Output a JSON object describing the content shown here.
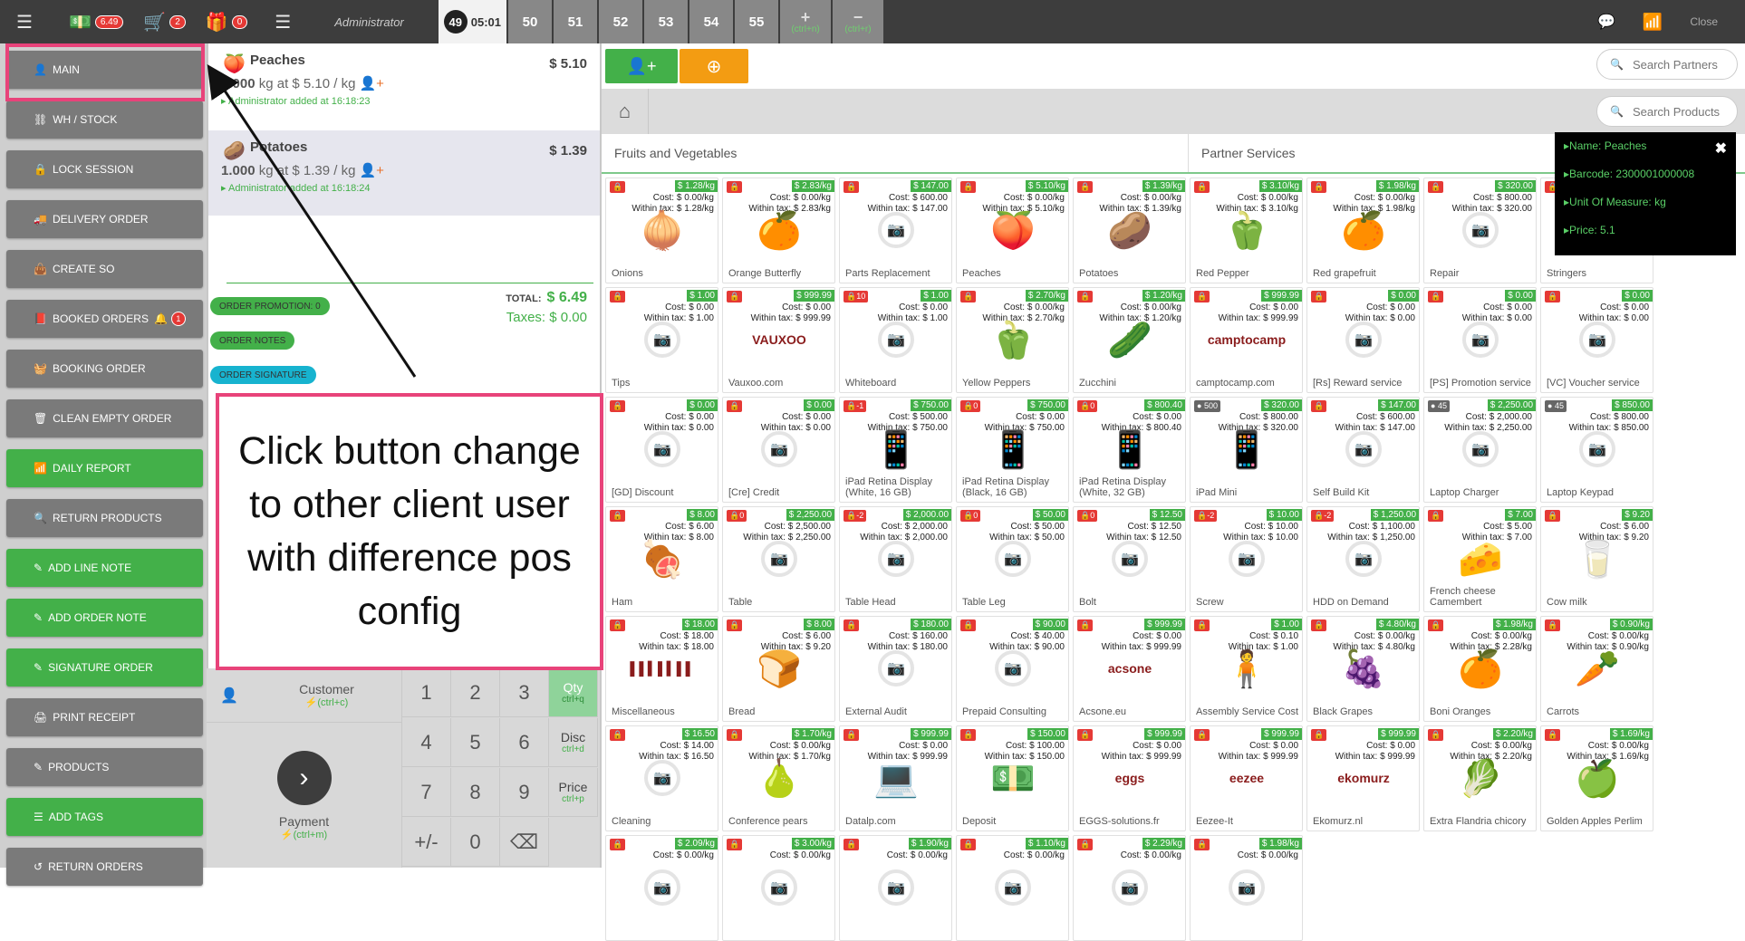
{
  "topbar": {
    "cash_badge": "6.49",
    "cart_badge": "2",
    "gift_badge": "0",
    "user": "Administrator",
    "active_order_number": "49",
    "active_order_time": "05:01",
    "order_tabs": [
      "50",
      "51",
      "52",
      "53",
      "54",
      "55"
    ],
    "add_label": "+",
    "add_shortcut": "(ctrl+n)",
    "remove_label": "−",
    "remove_shortcut": "(ctrl+r)",
    "close": "Close",
    "wifi_color": "#43b049"
  },
  "sidebar": {
    "items": [
      {
        "label": "MAIN",
        "icon": "user-icon",
        "style": "gray"
      },
      {
        "label": "WH / STOCK",
        "icon": "sitemap-icon",
        "style": "gray"
      },
      {
        "label": "LOCK SESSION",
        "icon": "lock-icon",
        "style": "gray"
      },
      {
        "label": "DELIVERY ORDER",
        "icon": "truck-icon",
        "style": "gray"
      },
      {
        "label": "CREATE SO",
        "icon": "bag-icon",
        "style": "gray"
      },
      {
        "label": "BOOKED ORDERS",
        "icon": "book-icon",
        "style": "gray",
        "count": "1"
      },
      {
        "label": "BOOKING ORDER",
        "icon": "basket-icon",
        "style": "gray"
      },
      {
        "label": "CLEAN EMPTY ORDER",
        "icon": "trash-icon",
        "style": "gray"
      },
      {
        "label": "DAILY REPORT",
        "icon": "signal-icon",
        "style": "green"
      },
      {
        "label": "RETURN PRODUCTS",
        "icon": "search-icon",
        "style": "gray"
      },
      {
        "label": "ADD LINE NOTE",
        "icon": "edit-icon",
        "style": "green"
      },
      {
        "label": "ADD ORDER NOTE",
        "icon": "edit-icon",
        "style": "green"
      },
      {
        "label": "SIGNATURE ORDER",
        "icon": "edit-icon",
        "style": "green"
      },
      {
        "label": "PRINT RECEIPT",
        "icon": "print-icon",
        "style": "gray"
      },
      {
        "label": "PRODUCTS",
        "icon": "edit-icon",
        "style": "gray"
      },
      {
        "label": "ADD TAGS",
        "icon": "sliders-icon",
        "style": "green"
      },
      {
        "label": "RETURN ORDERS",
        "icon": "undo-icon",
        "style": "gray"
      }
    ]
  },
  "order": {
    "lines": [
      {
        "name": "Peaches",
        "price": "$ 5.10",
        "qty": "1.000",
        "unit_text": "kg at $ 5.10 / kg",
        "added": "Administrator added at 16:18:23",
        "selected": false
      },
      {
        "name": "Potatoes",
        "price": "$ 1.39",
        "qty": "1.000",
        "unit_text": "kg at $ 1.39 / kg",
        "added": "Administrator added at 16:18:24",
        "selected": true
      }
    ],
    "total_label": "TOTAL:",
    "total": "$ 6.49",
    "taxes_label": "Taxes:",
    "taxes": "$ 0.00",
    "pills": [
      {
        "label": "ORDER PROMOTION: 0",
        "color": "#43b049"
      },
      {
        "label": "ORDER NOTES",
        "color": "#43b049"
      },
      {
        "label": "ORDER SIGNATURE",
        "color": "#17b3cf"
      }
    ]
  },
  "numpad": {
    "customer": "Customer",
    "customer_shortcut": "(ctrl+c)",
    "payment": "Payment",
    "payment_shortcut": "(ctrl+m)",
    "keys": [
      "1",
      "2",
      "3",
      "4",
      "5",
      "6",
      "7",
      "8",
      "9",
      "+/-",
      "0",
      "⌫"
    ],
    "modes": [
      {
        "label": "Qty",
        "shortcut": "ctrl+q",
        "active": true
      },
      {
        "label": "Disc",
        "shortcut": "ctrl+d",
        "active": false
      },
      {
        "label": "Price",
        "shortcut": "ctrl+p",
        "active": false
      }
    ]
  },
  "products_panel": {
    "search_partners": "Search Partners",
    "search_products": "Search Products",
    "categories": [
      "Fruits and Vegetables",
      "Partner Services"
    ]
  },
  "products": [
    {
      "name": "Onions",
      "badge": "$ 1.28/kg",
      "cost": "Cost: $ 0.00/kg",
      "tax": "Within tax: $ 1.28/kg",
      "img": "onion"
    },
    {
      "name": "Orange Butterfly",
      "badge": "$ 2.83/kg",
      "cost": "Cost: $ 0.00/kg",
      "tax": "Within tax: $ 2.83/kg",
      "img": "orange"
    },
    {
      "name": "Parts Replacement",
      "badge": "$ 147.00",
      "cost": "Cost: $ 600.00",
      "tax": "Within tax: $ 147.00",
      "img": ""
    },
    {
      "name": "Peaches",
      "badge": "$ 5.10/kg",
      "cost": "Cost: $ 0.00/kg",
      "tax": "Within tax: $ 5.10/kg",
      "img": "peach"
    },
    {
      "name": "Potatoes",
      "badge": "$ 1.39/kg",
      "cost": "Cost: $ 0.00/kg",
      "tax": "Within tax: $ 1.39/kg",
      "img": "potato"
    },
    {
      "name": "Red Pepper",
      "badge": "$ 3.10/kg",
      "cost": "Cost: $ 0.00/kg",
      "tax": "Within tax: $ 3.10/kg",
      "img": "redpepper"
    },
    {
      "name": "Red grapefruit",
      "badge": "$ 1.98/kg",
      "cost": "Cost: $ 0.00/kg",
      "tax": "Within tax: $ 1.98/kg",
      "img": "grapefruit"
    },
    {
      "name": "Repair",
      "badge": "$ 320.00",
      "cost": "Cost: $ 800.00",
      "tax": "Within tax: $ 320.00",
      "img": ""
    },
    {
      "name": "Stringers",
      "badge": "",
      "cost": "",
      "tax": "",
      "img": ""
    },
    {
      "name": "Tips",
      "badge": "$ 1.00",
      "cost": "Cost: $ 0.00",
      "tax": "Within tax: $ 1.00",
      "img": ""
    },
    {
      "name": "Vauxoo.com",
      "badge": "$ 999.99",
      "cost": "Cost: $ 0.00",
      "tax": "Within tax: $ 999.99",
      "img": "vauxoo"
    },
    {
      "name": "Whiteboard",
      "badge": "$ 1.00",
      "cost": "Cost: $ 0.00",
      "tax": "Within tax: $ 1.00",
      "img": "",
      "stock": "10"
    },
    {
      "name": "Yellow Peppers",
      "badge": "$ 2.70/kg",
      "cost": "Cost: $ 0.00/kg",
      "tax": "Within tax: $ 2.70/kg",
      "img": "yellowpepper"
    },
    {
      "name": "Zucchini",
      "badge": "$ 1.20/kg",
      "cost": "Cost: $ 0.00/kg",
      "tax": "Within tax: $ 1.20/kg",
      "img": "zucchini"
    },
    {
      "name": "camptocamp.com",
      "badge": "$ 999.99",
      "cost": "Cost: $ 0.00",
      "tax": "Within tax: $ 999.99",
      "img": "camptocamp"
    },
    {
      "name": "[Rs] Reward service",
      "badge": "$ 0.00",
      "cost": "Cost: $ 0.00",
      "tax": "Within tax: $ 0.00",
      "img": ""
    },
    {
      "name": "[PS] Promotion service",
      "badge": "$ 0.00",
      "cost": "Cost: $ 0.00",
      "tax": "Within tax: $ 0.00",
      "img": ""
    },
    {
      "name": "[VC] Voucher service",
      "badge": "$ 0.00",
      "cost": "Cost: $ 0.00",
      "tax": "Within tax: $ 0.00",
      "img": ""
    },
    {
      "name": "[GD] Discount",
      "badge": "$ 0.00",
      "cost": "Cost: $ 0.00",
      "tax": "Within tax: $ 0.00",
      "img": ""
    },
    {
      "name": "[Cre] Credit",
      "badge": "$ 0.00",
      "cost": "Cost: $ 0.00",
      "tax": "Within tax: $ 0.00",
      "img": ""
    },
    {
      "name": "iPad Retina Display (White, 16 GB)",
      "badge": "$ 750.00",
      "cost": "Cost: $ 500.00",
      "tax": "Within tax: $ 750.00",
      "img": "ipad",
      "stock": "-1"
    },
    {
      "name": "iPad Retina Display (Black, 16 GB)",
      "badge": "$ 750.00",
      "cost": "Cost: $ 0.00",
      "tax": "Within tax: $ 750.00",
      "img": "ipad",
      "stock": "0"
    },
    {
      "name": "iPad Retina Display (White, 32 GB)",
      "badge": "$ 800.40",
      "cost": "Cost: $ 0.00",
      "tax": "Within tax: $ 800.40",
      "img": "ipad",
      "stock": "0"
    },
    {
      "name": "iPad Mini",
      "badge": "$ 320.00",
      "cost": "Cost: $ 800.00",
      "tax": "Within tax: $ 320.00",
      "img": "ipadmini",
      "stock": "500",
      "stock_ok": true
    },
    {
      "name": "Self Build Kit",
      "badge": "$ 147.00",
      "cost": "Cost: $ 600.00",
      "tax": "Within tax: $ 147.00",
      "img": ""
    },
    {
      "name": "Laptop Charger",
      "badge": "$ 2,250.00",
      "cost": "Cost: $ 2,000.00",
      "tax": "Within tax: $ 2,250.00",
      "img": "",
      "stock": "45",
      "stock_ok": true
    },
    {
      "name": "Laptop Keypad",
      "badge": "$ 850.00",
      "cost": "Cost: $ 800.00",
      "tax": "Within tax: $ 850.00",
      "img": "",
      "stock": "45",
      "stock_ok": true
    },
    {
      "name": "Ham",
      "badge": "$ 8.00",
      "cost": "Cost: $ 6.00",
      "tax": "Within tax: $ 8.00",
      "img": "ham"
    },
    {
      "name": "Table",
      "badge": "$ 2,250.00",
      "cost": "Cost: $ 2,500.00",
      "tax": "Within tax: $ 2,250.00",
      "img": "",
      "stock": "0"
    },
    {
      "name": "Table Head",
      "badge": "$ 2,000.00",
      "cost": "Cost: $ 2,000.00",
      "tax": "Within tax: $ 2,000.00",
      "img": "",
      "stock": "-2"
    },
    {
      "name": "Table Leg",
      "badge": "$ 50.00",
      "cost": "Cost: $ 50.00",
      "tax": "Within tax: $ 50.00",
      "img": "",
      "stock": "0"
    },
    {
      "name": "Bolt",
      "badge": "$ 12.50",
      "cost": "Cost: $ 12.50",
      "tax": "Within tax: $ 12.50",
      "img": "",
      "stock": "0"
    },
    {
      "name": "Screw",
      "badge": "$ 10.00",
      "cost": "Cost: $ 10.00",
      "tax": "Within tax: $ 10.00",
      "img": "",
      "stock": "-2"
    },
    {
      "name": "HDD on Demand",
      "badge": "$ 1,250.00",
      "cost": "Cost: $ 1,100.00",
      "tax": "Within tax: $ 1,250.00",
      "img": "",
      "stock": "-2"
    },
    {
      "name": "French cheese Camembert",
      "badge": "$ 7.00",
      "cost": "Cost: $ 5.00",
      "tax": "Within tax: $ 7.00",
      "img": "cheese"
    },
    {
      "name": "Cow milk",
      "badge": "$ 9.20",
      "cost": "Cost: $ 6.00",
      "tax": "Within tax: $ 9.20",
      "img": "milk"
    },
    {
      "name": "Miscellaneous",
      "badge": "$ 18.00",
      "cost": "Cost: $ 18.00",
      "tax": "Within tax: $ 18.00",
      "img": "barcode"
    },
    {
      "name": "Bread",
      "badge": "$ 8.00",
      "cost": "Cost: $ 6.00",
      "tax": "Within tax: $ 9.20",
      "img": "bread"
    },
    {
      "name": "External Audit",
      "badge": "$ 180.00",
      "cost": "Cost: $ 160.00",
      "tax": "Within tax: $ 180.00",
      "img": ""
    },
    {
      "name": "Prepaid Consulting",
      "badge": "$ 90.00",
      "cost": "Cost: $ 40.00",
      "tax": "Within tax: $ 90.00",
      "img": ""
    },
    {
      "name": "Acsone.eu",
      "badge": "$ 999.99",
      "cost": "Cost: $ 0.00",
      "tax": "Within tax: $ 999.99",
      "img": "acsone"
    },
    {
      "name": "Assembly Service Cost",
      "badge": "$ 1.00",
      "cost": "Cost: $ 0.10",
      "tax": "Within tax: $ 1.00",
      "img": "assembly"
    },
    {
      "name": "Black Grapes",
      "badge": "$ 4.80/kg",
      "cost": "Cost: $ 0.00/kg",
      "tax": "Within tax: $ 4.80/kg",
      "img": "grapes"
    },
    {
      "name": "Boni Oranges",
      "badge": "$ 1.98/kg",
      "cost": "Cost: $ 0.00/kg",
      "tax": "Within tax: $ 2.28/kg",
      "img": "orange2"
    },
    {
      "name": "Carrots",
      "badge": "$ 0.90/kg",
      "cost": "Cost: $ 0.00/kg",
      "tax": "Within tax: $ 0.90/kg",
      "img": "carrot"
    },
    {
      "name": "Cleaning",
      "badge": "$ 16.50",
      "cost": "Cost: $ 14.00",
      "tax": "Within tax: $ 16.50",
      "img": ""
    },
    {
      "name": "Conference pears",
      "badge": "$ 1.70/kg",
      "cost": "Cost: $ 0.00/kg",
      "tax": "Within tax: $ 1.70/kg",
      "img": "pear"
    },
    {
      "name": "Datalp.com",
      "badge": "$ 999.99",
      "cost": "Cost: $ 0.00",
      "tax": "Within tax: $ 999.99",
      "img": "datalp"
    },
    {
      "name": "Deposit",
      "badge": "$ 150.00",
      "cost": "Cost: $ 100.00",
      "tax": "Within tax: $ 150.00",
      "img": "deposit"
    },
    {
      "name": "EGGS-solutions.fr",
      "badge": "$ 999.99",
      "cost": "Cost: $ 0.00",
      "tax": "Within tax: $ 999.99",
      "img": "eggs"
    },
    {
      "name": "Eezee-It",
      "badge": "$ 999.99",
      "cost": "Cost: $ 0.00",
      "tax": "Within tax: $ 999.99",
      "img": "eezee"
    },
    {
      "name": "Ekomurz.nl",
      "badge": "$ 999.99",
      "cost": "Cost: $ 0.00",
      "tax": "Within tax: $ 999.99",
      "img": "ekomurz"
    },
    {
      "name": "Extra Flandria chicory",
      "badge": "$ 2.20/kg",
      "cost": "Cost: $ 0.00/kg",
      "tax": "Within tax: $ 2.20/kg",
      "img": "chicory"
    },
    {
      "name": "Golden Apples Perlim",
      "badge": "$ 1.69/kg",
      "cost": "Cost: $ 0.00/kg",
      "tax": "Within tax: $ 1.69/kg",
      "img": "apple"
    },
    {
      "name": "",
      "badge": "$ 2.09/kg",
      "cost": "Cost: $ 0.00/kg",
      "tax": "",
      "img": ""
    },
    {
      "name": "",
      "badge": "$ 3.00/kg",
      "cost": "Cost: $ 0.00/kg",
      "tax": "",
      "img": ""
    },
    {
      "name": "",
      "badge": "$ 1.90/kg",
      "cost": "Cost: $ 0.00/kg",
      "tax": "",
      "img": ""
    },
    {
      "name": "",
      "badge": "$ 1.10/kg",
      "cost": "Cost: $ 0.00/kg",
      "tax": "",
      "img": ""
    },
    {
      "name": "",
      "badge": "$ 2.29/kg",
      "cost": "Cost: $ 0.00/kg",
      "tax": "",
      "img": ""
    },
    {
      "name": "",
      "badge": "$ 1.98/kg",
      "cost": "Cost: $ 0.00/kg",
      "tax": "",
      "img": ""
    }
  ],
  "tooltip": {
    "lines": [
      "Name: Peaches",
      "Barcode: 2300001000008",
      "Unit Of Measure: kg",
      "Price: 5.1"
    ]
  },
  "annotation": {
    "text": "Click button change to other client user with difference pos config",
    "color": "#e8437a"
  }
}
